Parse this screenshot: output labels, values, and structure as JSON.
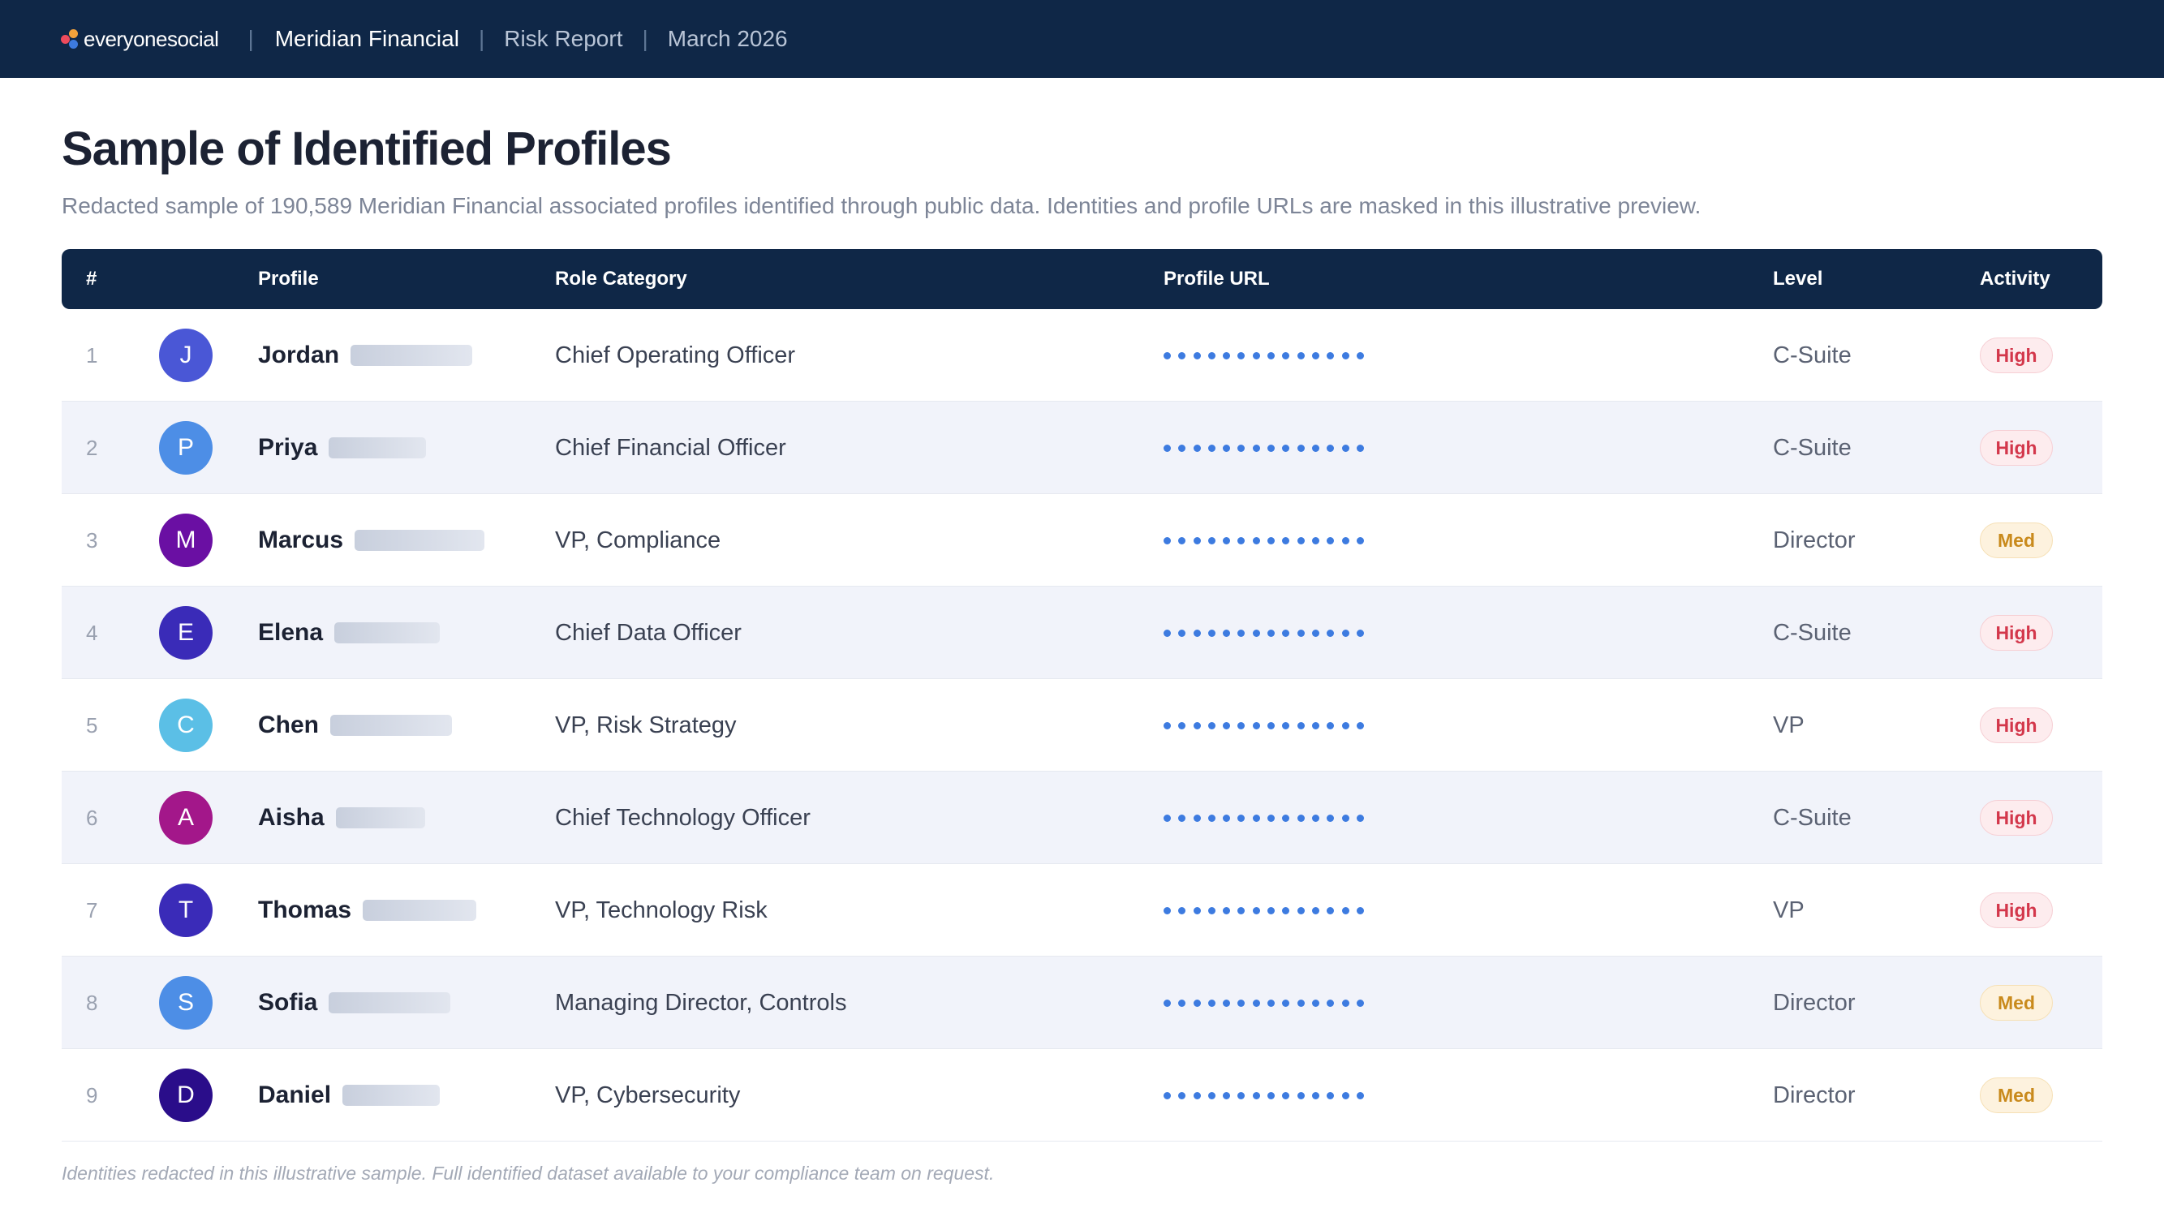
{
  "header": {
    "brand": "everyonesocial",
    "separator": "|",
    "company": "Meridian Financial",
    "report": "Risk Report",
    "date": "March 2026"
  },
  "page": {
    "title": "Sample of Identified Profiles",
    "subtitle": "Redacted sample of 190,589 Meridian Financial associated profiles identified through public data. Identities and profile URLs are masked in this illustrative preview.",
    "footnote": "Identities redacted in this illustrative sample. Full identified dataset available to your compliance team on request."
  },
  "table": {
    "columns": [
      "#",
      "Profile",
      "Role Category",
      "Profile URL",
      "Level",
      "Activity"
    ],
    "rows": [
      {
        "num": "1",
        "initial": "J",
        "name": "Jordan",
        "role": "Chief Operating Officer",
        "level": "C-Suite",
        "activity": "High",
        "avatar_color": "#4a57d6"
      },
      {
        "num": "2",
        "initial": "P",
        "name": "Priya",
        "role": "Chief Financial Officer",
        "level": "C-Suite",
        "activity": "High",
        "avatar_color": "#4d8ee6"
      },
      {
        "num": "3",
        "initial": "M",
        "name": "Marcus",
        "role": "VP, Compliance",
        "level": "Director",
        "activity": "Med",
        "avatar_color": "#6a0fa3"
      },
      {
        "num": "4",
        "initial": "E",
        "name": "Elena",
        "role": "Chief Data Officer",
        "level": "C-Suite",
        "activity": "High",
        "avatar_color": "#3a2bb8"
      },
      {
        "num": "5",
        "initial": "C",
        "name": "Chen",
        "role": "VP, Risk Strategy",
        "level": "VP",
        "activity": "High",
        "avatar_color": "#5bbfe6"
      },
      {
        "num": "6",
        "initial": "A",
        "name": "Aisha",
        "role": "Chief Technology Officer",
        "level": "C-Suite",
        "activity": "High",
        "avatar_color": "#a3178a"
      },
      {
        "num": "7",
        "initial": "T",
        "name": "Thomas",
        "role": "VP, Technology Risk",
        "level": "VP",
        "activity": "High",
        "avatar_color": "#3a2bb8"
      },
      {
        "num": "8",
        "initial": "S",
        "name": "Sofia",
        "role": "Managing Director, Controls",
        "level": "Director",
        "activity": "Med",
        "avatar_color": "#4d8ee6"
      },
      {
        "num": "9",
        "initial": "D",
        "name": "Daniel",
        "role": "VP, Cybersecurity",
        "level": "Director",
        "activity": "Med",
        "avatar_color": "#2a0d8a"
      }
    ]
  },
  "colors": {
    "header_bg": "#0f2747",
    "url_dots": "#3d7be0",
    "high": "#d3374b",
    "med": "#c98a1c"
  }
}
